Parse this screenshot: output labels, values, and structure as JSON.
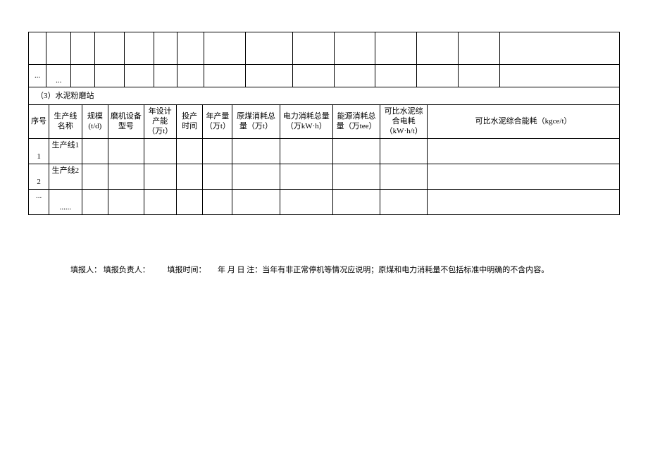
{
  "topRow": {
    "left": "...",
    "dots": "..."
  },
  "sectionTitle": "（3）水泥粉磨站",
  "headers": {
    "c1": "序号",
    "c2": "生产线名称",
    "c3": "规模(t/d)",
    "c4": "磨机设备型号",
    "c5": "年设计产能（万t）",
    "c6": "投产时间",
    "c7": "年产量（万t）",
    "c8": "原煤消耗总量（万t）",
    "c9": "电力消耗总量（万kW·h）",
    "c10": "能源消耗总量（万tee）",
    "c11": "可比水泥综合电耗（kW·h/t）",
    "c12": "可比水泥综合能耗（kgce/t）"
  },
  "rows": [
    {
      "num": "1",
      "name": "生产线1"
    },
    {
      "num": "2",
      "name": "生产线2"
    },
    {
      "num": "...",
      "name": "......"
    }
  ],
  "footer": {
    "reporter": "填报人：",
    "responsible": "填报负责人：",
    "time": "填报时间：",
    "date": "年 月 日",
    "note": "注：当年有非正常停机等情况应说明；原煤和电力消耗量不包括标准中明确的不含内容。"
  }
}
